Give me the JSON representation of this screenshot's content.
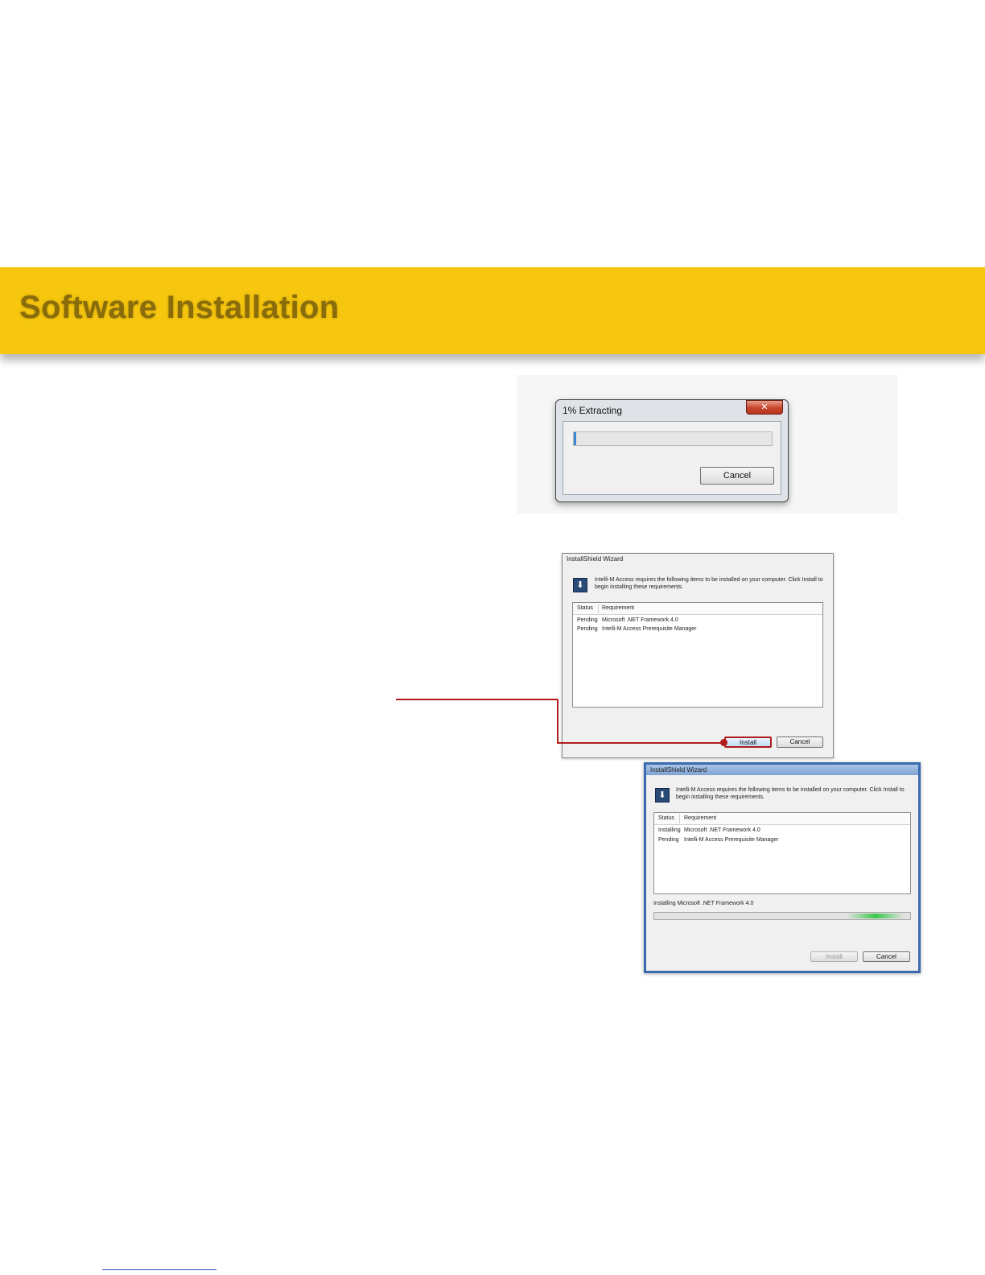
{
  "section": {
    "title": "Software Installation"
  },
  "extract_dialog": {
    "title": "1% Extracting",
    "close_glyph": "✕",
    "progress": 0.01,
    "cancel_label": "Cancel"
  },
  "wizard_pending": {
    "title": "InstallShield Wizard",
    "icon_glyph": "⬇",
    "message": "Intelli-M Access requires the following items to be installed on your computer. Click Install to begin installing these requirements.",
    "columns": [
      "Status",
      "Requirement"
    ],
    "rows": [
      {
        "status": "Pending",
        "requirement": "Microsoft .NET Framework 4.0"
      },
      {
        "status": "Pending",
        "requirement": "Intelli-M Access Prerequisite Manager"
      }
    ],
    "install_label": "Install",
    "cancel_label": "Cancel"
  },
  "wizard_installing": {
    "title": "InstallShield Wizard",
    "icon_glyph": "⬇",
    "message": "Intelli-M Access requires the following items to be installed on your computer. Click Install to begin installing these requirements.",
    "columns": [
      "Status",
      "Requirement"
    ],
    "rows": [
      {
        "status": "Installing",
        "requirement": "Microsoft .NET Framework 4.0"
      },
      {
        "status": "Pending",
        "requirement": "Intelli-M Access Prerequisite Manager"
      }
    ],
    "progress_text": "Installing Microsoft .NET Framework 4.0",
    "install_label": "Install",
    "cancel_label": "Cancel"
  },
  "colors": {
    "banner": "#f7c70f",
    "callout": "#b01c1c",
    "title_text": "#8a6d0a"
  }
}
